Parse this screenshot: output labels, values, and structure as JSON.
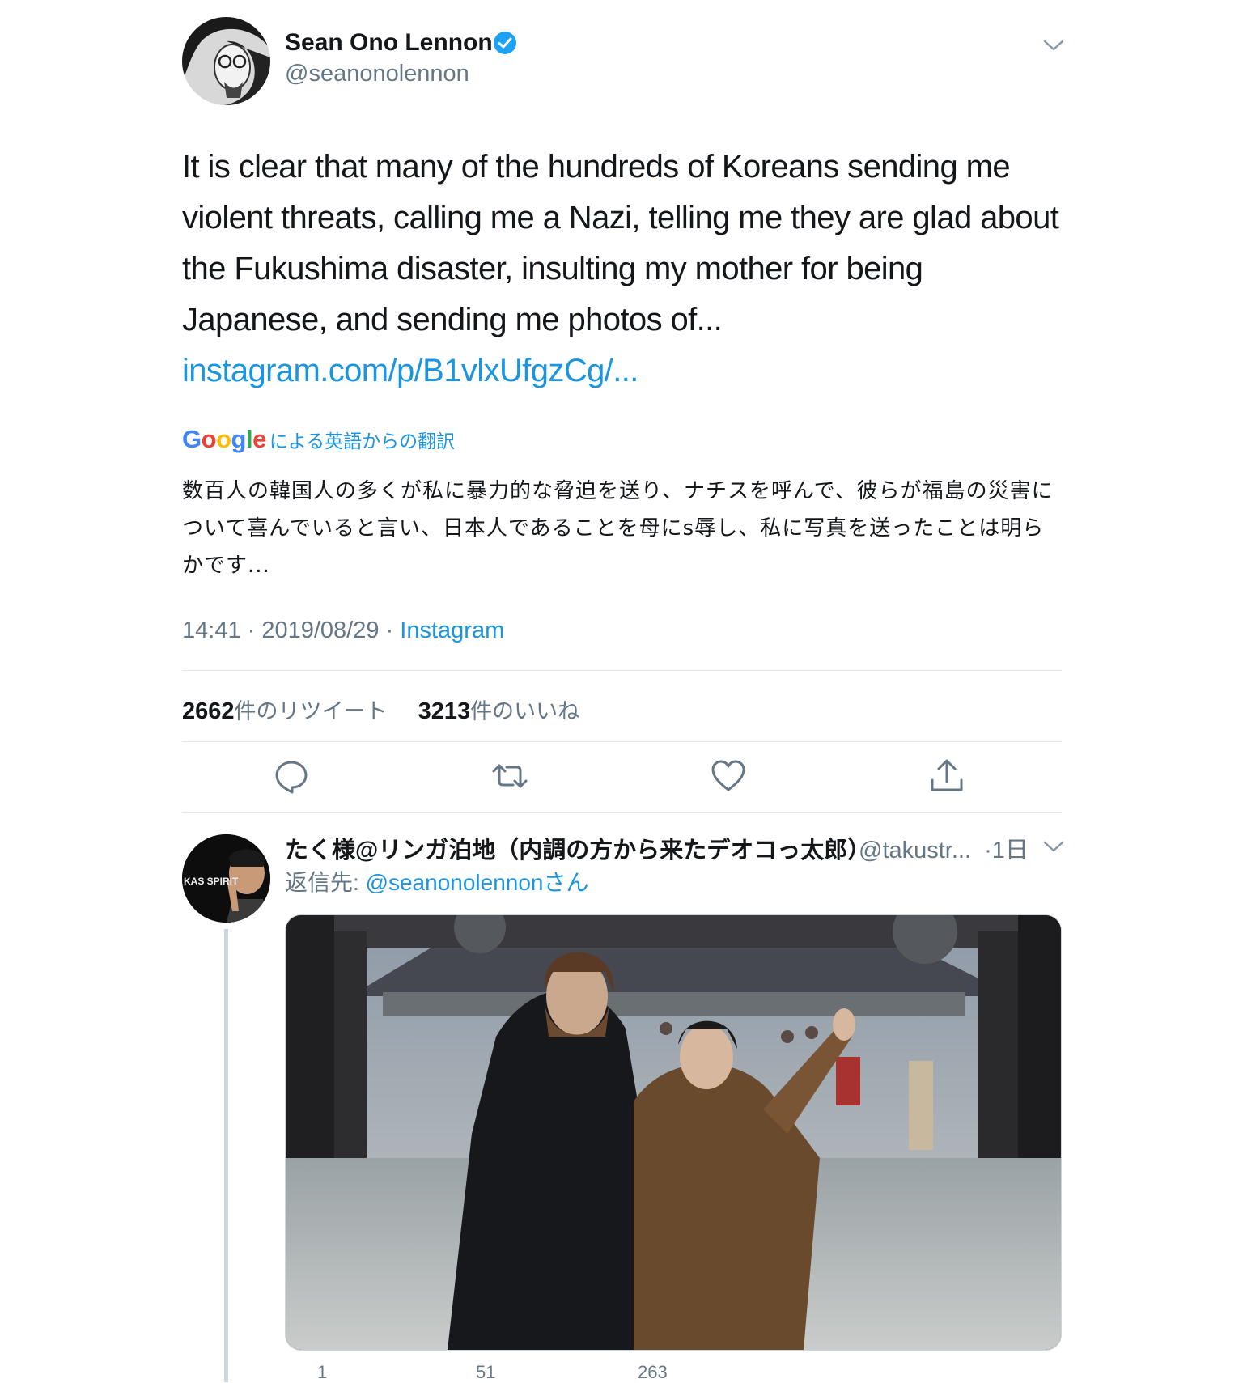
{
  "tweet": {
    "author_name": "Sean Ono Lennon",
    "author_handle": "@seanonolennon",
    "text": "It is clear that many of the hundreds of Koreans sending me violent threats, calling me a Nazi, telling me they are glad about the Fukushima disaster, insulting my mother for being Japanese, and sending me photos of... ",
    "link": "instagram.com/p/B1vlxUfgzCg/...",
    "translation": {
      "google_label": "Google",
      "label": "による英語からの翻訳",
      "text": "数百人の韓国人の多くが私に暴力的な脅迫を送り、ナチスを呼んで、彼らが福島の災害について喜んでいると言い、日本人であることを母にs辱し、私に写真を送ったことは明らかです..."
    },
    "time": "14:41",
    "date": "2019/08/29",
    "source": "Instagram",
    "retweets": "2662",
    "retweets_label": "件のリツイート",
    "likes": "3213",
    "likes_label": "件のいいね"
  },
  "reply": {
    "author_name": "たく様@リンガ泊地（内調の方から来たデオコっ太郎）",
    "author_handle": "@takustr...",
    "age": "·1日",
    "reply_to_label": "返信先: ",
    "reply_to_handle": "@seanonolennonさん",
    "avatar_text": "KAS SPIRIT",
    "counts": {
      "replies": "1",
      "retweets": "51",
      "likes": "263"
    }
  },
  "colors": {
    "link": "#1b95e0",
    "secondary_text": "#657786",
    "divider": "#e1e8ed",
    "verified": "#1da1f2"
  },
  "icons": [
    "chevron-down-icon",
    "verified-badge-icon",
    "reply-icon",
    "retweet-icon",
    "like-icon",
    "share-icon"
  ]
}
